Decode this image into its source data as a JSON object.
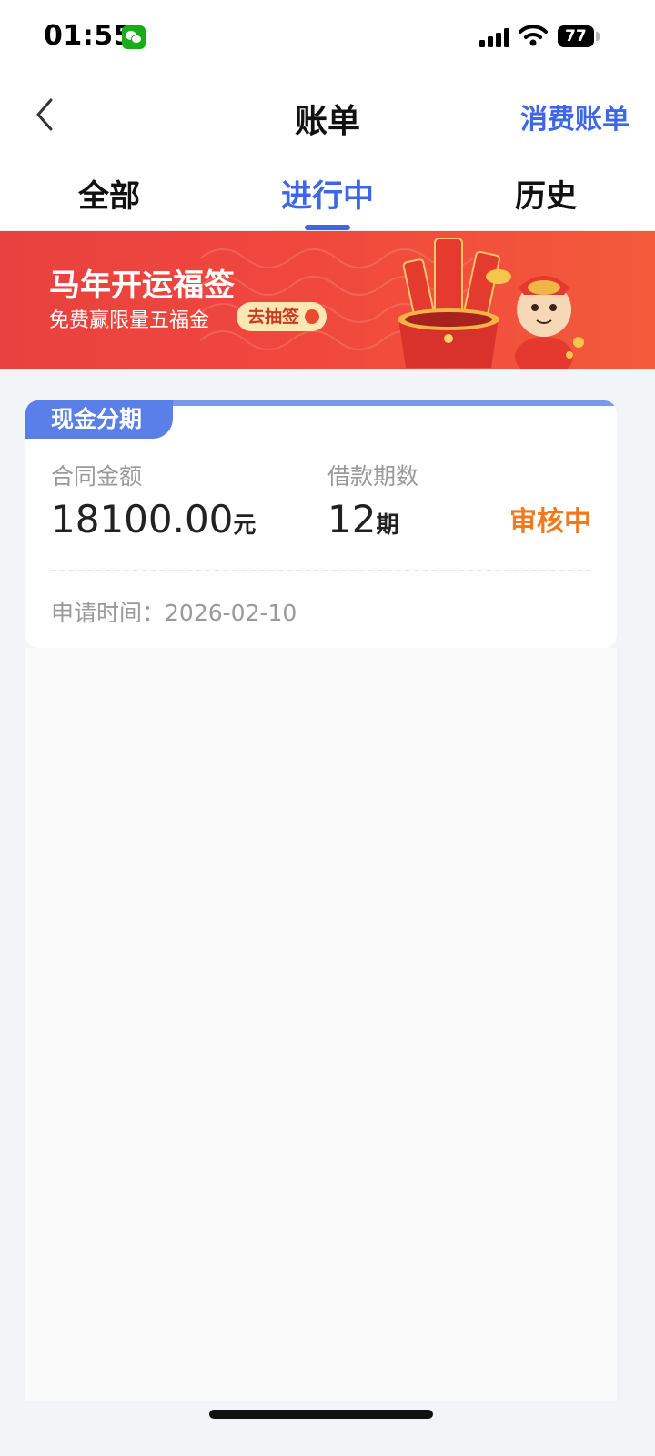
{
  "status_bar": {
    "time": "01:55",
    "battery": "77"
  },
  "nav": {
    "title": "账单",
    "right_link": "消费账单"
  },
  "tabs": [
    {
      "label": "全部",
      "active": false
    },
    {
      "label": "进行中",
      "active": true
    },
    {
      "label": "历史",
      "active": false
    }
  ],
  "banner": {
    "title": "马年开运福签",
    "subtitle": "免费赢限量五福金",
    "button": "去抽签"
  },
  "card": {
    "tag": "现金分期",
    "amount_label": "合同金额",
    "amount_value": "18100.00",
    "amount_unit": "元",
    "periods_label": "借款期数",
    "periods_value": "12",
    "periods_unit": "期",
    "status": "审核中",
    "apply_time_label": "申请时间：",
    "apply_time_value": "2026-02-10"
  },
  "colors": {
    "accent": "#3e66e8",
    "status": "#f07a1f",
    "banner": "#f0473d"
  }
}
